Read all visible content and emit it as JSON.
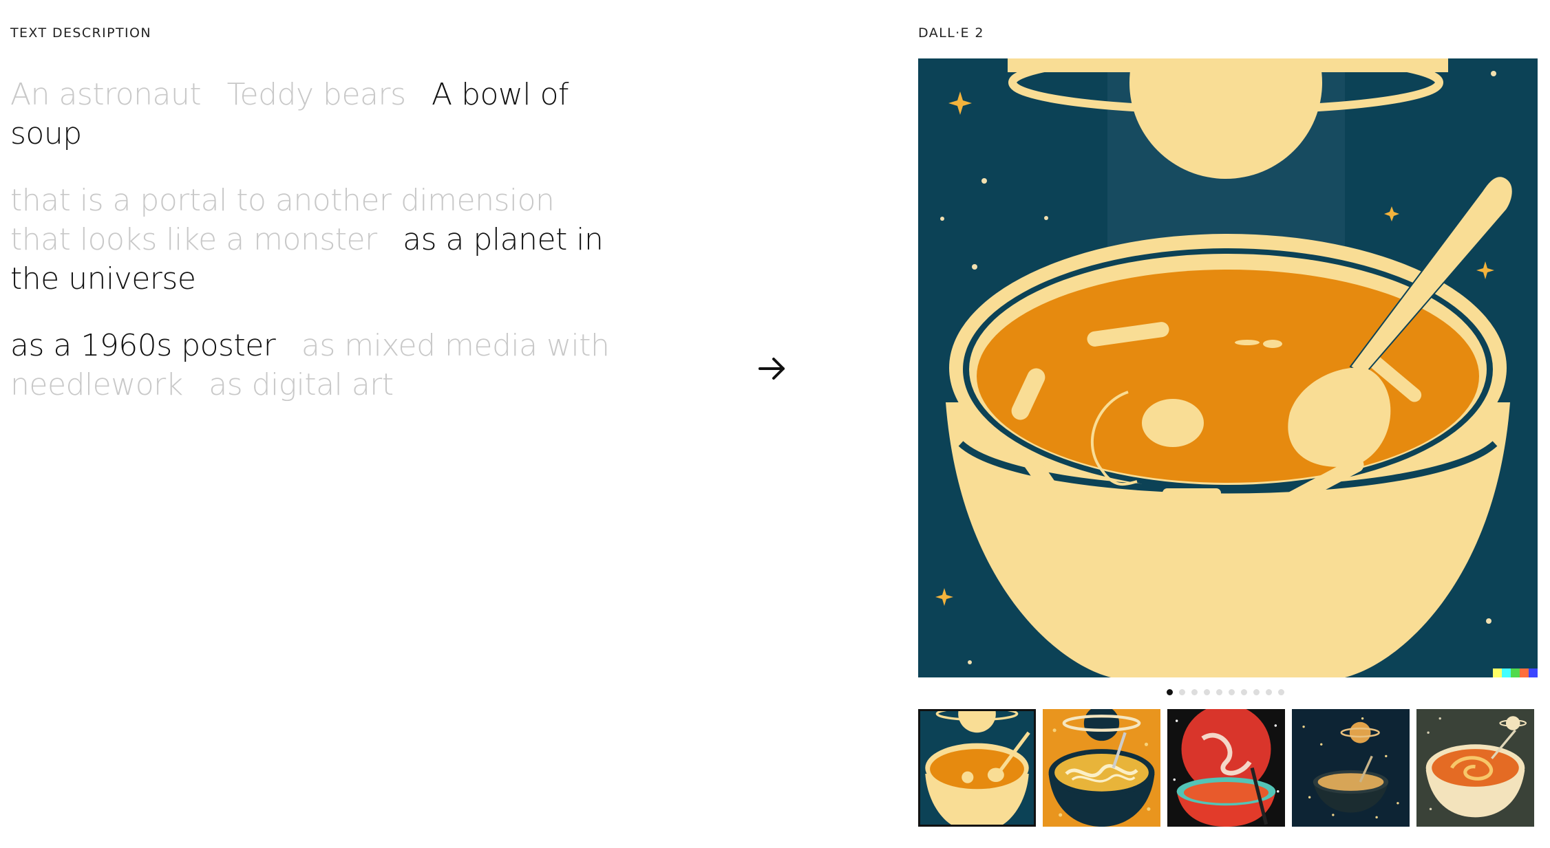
{
  "left_panel": {
    "label": "TEXT DESCRIPTION",
    "subjects": [
      {
        "text": "An astronaut",
        "selected": false
      },
      {
        "text": "Teddy bears",
        "selected": false
      },
      {
        "text": "A bowl of soup",
        "selected": true
      }
    ],
    "modifiers": [
      {
        "text": "that is a portal to another dimension",
        "selected": false
      },
      {
        "text": "that looks like a monster",
        "selected": false
      },
      {
        "text": "as a planet in the universe",
        "selected": true
      }
    ],
    "styles": [
      {
        "text": "as a 1960s poster",
        "selected": true
      },
      {
        "text": "as mixed media with needlework",
        "selected": false
      },
      {
        "text": "as digital art",
        "selected": false
      }
    ]
  },
  "arrow_icon": "arrow-right-icon",
  "right_panel": {
    "label": "DALL·E 2",
    "carousel": {
      "total": 10,
      "active": 0
    },
    "thumbnails": [
      {
        "name": "thumbnail-soup-saturn-poster",
        "active": true
      },
      {
        "name": "thumbnail-soup-noodles-orange",
        "active": false
      },
      {
        "name": "thumbnail-soup-red-planet",
        "active": false
      },
      {
        "name": "thumbnail-soup-starry-night",
        "active": false
      },
      {
        "name": "thumbnail-soup-swirl-space",
        "active": false
      }
    ],
    "watermark_colors": [
      "#ffff66",
      "#42ffff",
      "#51da4c",
      "#ff6e3c",
      "#3c46ff"
    ]
  },
  "colors": {
    "unselected_text": "#c8c8c8",
    "selected_text": "#111111",
    "poster_navy": "#0c4256",
    "poster_cream": "#f9dd95",
    "poster_orange": "#e68a0f"
  }
}
